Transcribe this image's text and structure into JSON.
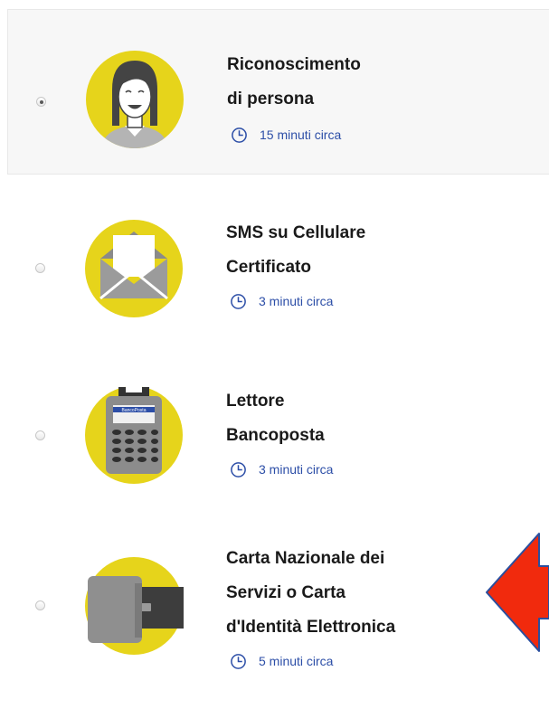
{
  "options": [
    {
      "title_lines": [
        "Riconoscimento",
        "di persona"
      ],
      "duration": "15 minuti circa",
      "selected": true,
      "icon": "person-face-icon"
    },
    {
      "title_lines": [
        "SMS su Cellulare",
        "Certificato"
      ],
      "duration": "3 minuti circa",
      "selected": false,
      "icon": "envelope-letter-icon"
    },
    {
      "title_lines": [
        "Lettore",
        "Bancoposta"
      ],
      "duration": "3 minuti circa",
      "selected": false,
      "icon": "card-reader-icon",
      "icon_text": "BancoPosta"
    },
    {
      "title_lines": [
        "Carta Nazionale dei",
        "Servizi o Carta",
        "d'Identità Elettronica"
      ],
      "duration": "5 minuti circa",
      "selected": false,
      "icon": "smart-card-icon"
    }
  ],
  "annotation": {
    "icon": "red-arrow-icon",
    "color": "#f12a0d"
  },
  "colors": {
    "accent_yellow": "#e6d41b",
    "link_blue": "#2c4ea7",
    "title_text": "#1a1a1a"
  }
}
